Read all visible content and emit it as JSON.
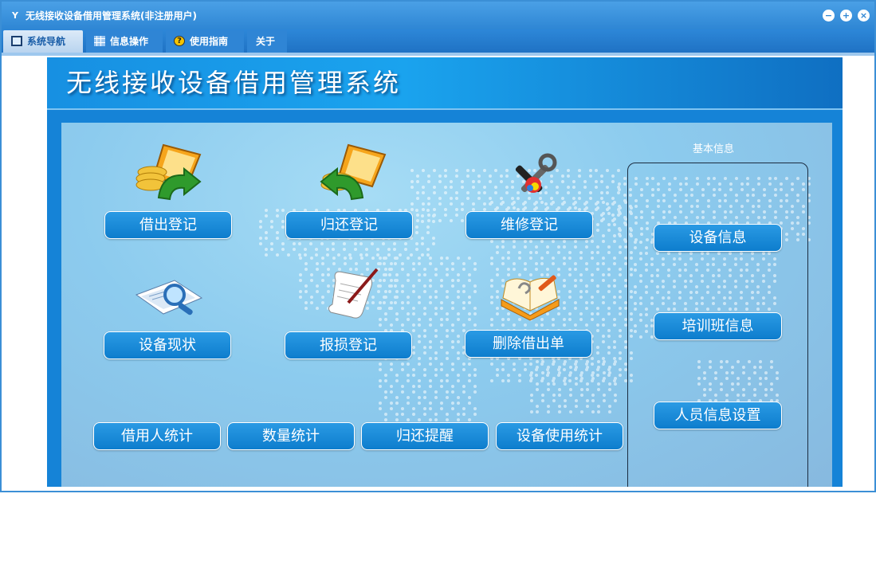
{
  "window": {
    "title": "无线接收设备借用管理系统(非注册用户)",
    "app_icon": "Y",
    "controls": {
      "minimize": "−",
      "maximize": "+",
      "close": "×"
    }
  },
  "menu": [
    {
      "label": "系统导航",
      "icon": "monitor-icon"
    },
    {
      "label": "信息操作",
      "icon": "grid-icon"
    },
    {
      "label": "使用指南",
      "icon": "help-icon"
    },
    {
      "label": "关于"
    }
  ],
  "banner": {
    "title": "无线接收设备借用管理系统"
  },
  "actions": {
    "borrow": "借出登记",
    "return": "归还登记",
    "repair": "维修登记",
    "status": "设备现状",
    "damage": "报损登记",
    "delete": "删除借出单",
    "borrower_stats": "借用人统计",
    "quantity_stats": "数量统计",
    "return_reminder": "归还提醒",
    "usage_stats": "设备使用统计"
  },
  "basic_info": {
    "title": "基本信息",
    "items": [
      "设备信息",
      "培训班信息",
      "人员信息设置"
    ]
  },
  "colors": {
    "titlebar": "#3a93dc",
    "button": "#1a8bd8",
    "banner": "#1583d7",
    "content_bg": "#8ccbee"
  }
}
